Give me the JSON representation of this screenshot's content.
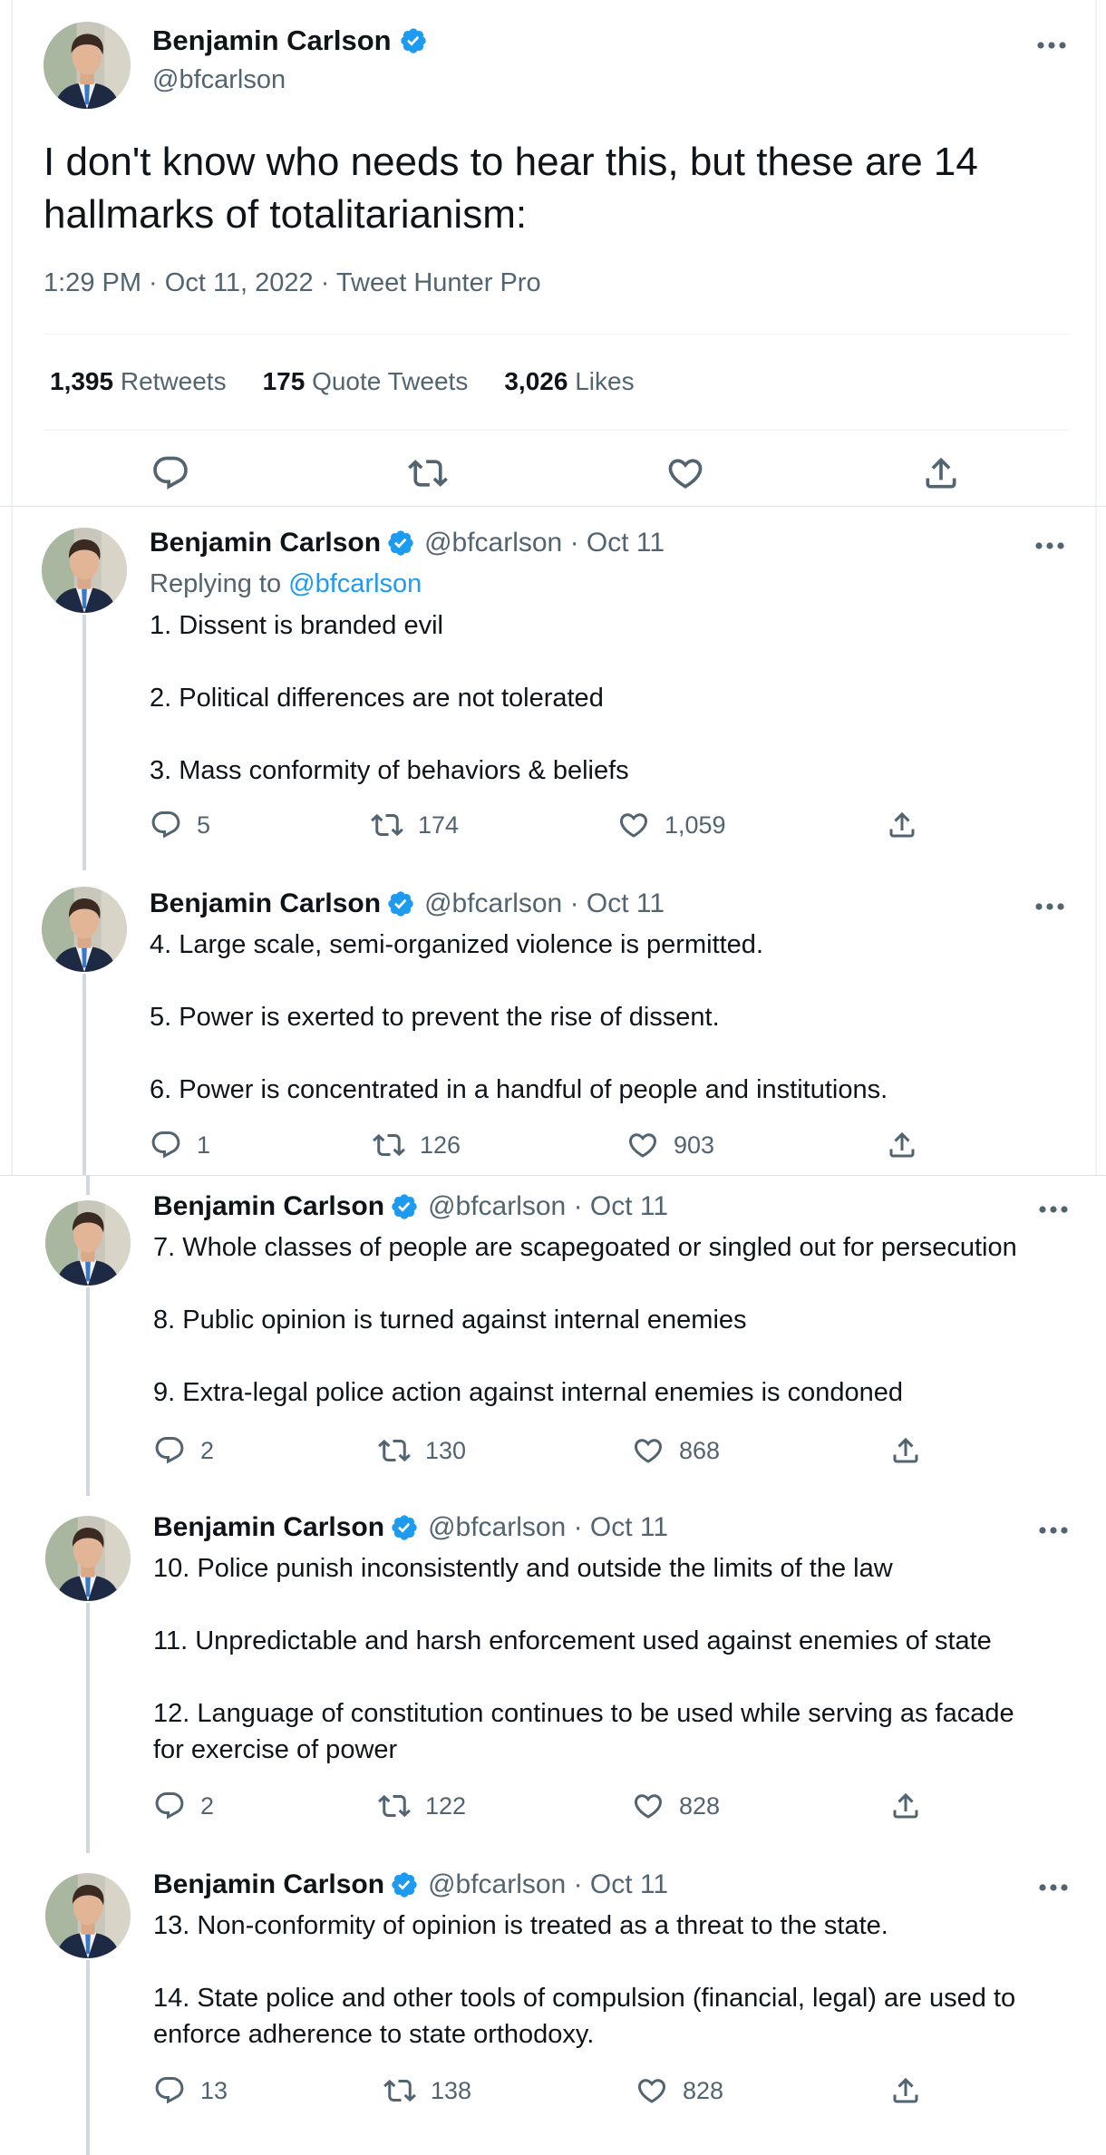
{
  "author": {
    "name": "Benjamin Carlson",
    "handle": "@bfcarlson"
  },
  "main": {
    "text": "I don't know who needs to hear this, but these are 14 hallmarks of totalitarianism:",
    "meta": "1:29 PM · Oct 11, 2022 · Tweet Hunter Pro",
    "retweets": {
      "count": "1,395",
      "label": "Retweets"
    },
    "quotes": {
      "count": "175",
      "label": "Quote Tweets"
    },
    "likes": {
      "count": "3,026",
      "label": "Likes"
    }
  },
  "replies": [
    {
      "name": "Benjamin Carlson",
      "handle": "@bfcarlson · Oct 11",
      "replying_prefix": "Replying to ",
      "replying_to": "@bfcarlson",
      "lines": [
        "1. Dissent is branded evil",
        "",
        "2. Political differences are not tolerated",
        "",
        "3. Mass conformity of behaviors & beliefs"
      ],
      "stats": {
        "replies": "5",
        "retweets": "174",
        "likes": "1,059"
      }
    },
    {
      "name": "Benjamin Carlson",
      "handle": "@bfcarlson · Oct 11",
      "lines": [
        "4. Large scale, semi-organized violence is permitted.",
        "",
        "5. Power is exerted to prevent the rise of dissent.",
        "",
        "6. Power is concentrated in a handful of people and institutions."
      ],
      "stats": {
        "replies": "1",
        "retweets": "126",
        "likes": "903"
      }
    },
    {
      "name": "Benjamin Carlson",
      "handle": "@bfcarlson · Oct 11",
      "lines": [
        "7. Whole classes of people are scapegoated or singled out for persecution",
        "",
        "8. Public opinion is turned against internal enemies",
        "",
        "9. Extra-legal police action against internal enemies is condoned"
      ],
      "stats": {
        "replies": "2",
        "retweets": "130",
        "likes": "868"
      }
    },
    {
      "name": "Benjamin Carlson",
      "handle": "@bfcarlson · Oct 11",
      "lines": [
        "10. Police punish inconsistently and outside the limits of the law",
        "",
        "11. Unpredictable and harsh enforcement used against enemies of state",
        "",
        "12. Language of constitution continues to be used while serving as facade",
        "for exercise of power"
      ],
      "stats": {
        "replies": "2",
        "retweets": "122",
        "likes": "828"
      }
    },
    {
      "name": "Benjamin Carlson",
      "handle": "@bfcarlson · Oct 11",
      "lines": [
        "13. Non-conformity of opinion is treated as a threat to the state.",
        "",
        "14. State police and other tools of compulsion (financial, legal) are used to",
        "enforce adherence to state orthodoxy."
      ],
      "stats": {
        "replies": "13",
        "retweets": "138",
        "likes": "828"
      }
    }
  ],
  "colors": {
    "text": "#0f1419",
    "muted": "#536471",
    "link": "#1d9bf0",
    "verified": "#1d9bf0",
    "thread_line": "#cfd9de",
    "divider": "#eff3f4"
  },
  "icons": [
    "verified-badge-icon",
    "more-icon",
    "reply-icon",
    "retweet-icon",
    "like-icon",
    "share-icon"
  ]
}
